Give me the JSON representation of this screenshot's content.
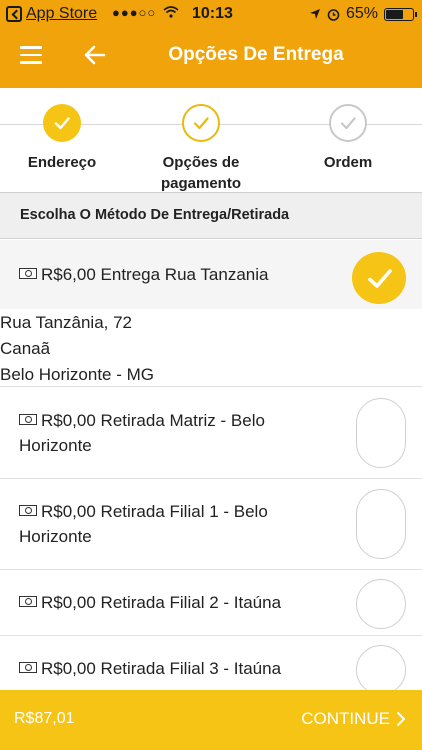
{
  "status_bar": {
    "back_app_label": "App Store",
    "signal": "●●●○○",
    "time": "10:13",
    "battery": "65%",
    "battery_level": 0.65
  },
  "header": {
    "title": "Opções De Entrega"
  },
  "stepper": {
    "steps": [
      {
        "label": "Endereço",
        "state": "done"
      },
      {
        "label": "Opções de pagamento",
        "state": "current"
      },
      {
        "label": "Ordem",
        "state": "todo"
      }
    ]
  },
  "section": {
    "title": "Escolha O Método De Entrega/Retirada"
  },
  "options": [
    {
      "label": "R$6,00 Entrega Rua Tanzania",
      "selected": true
    },
    {
      "label": "R$0,00 Retirada Matriz - Belo Horizonte",
      "selected": false
    },
    {
      "label": "R$0,00 Retirada Filial 1 - Belo Horizonte",
      "selected": false
    },
    {
      "label": "R$0,00 Retirada Filial 2 - Itaúna",
      "selected": false
    },
    {
      "label": "R$0,00 Retirada Filial 3 - Itaúna",
      "selected": false
    }
  ],
  "address": {
    "line1": "Rua Tanzânia, 72",
    "line2": "Canaã",
    "line3": "Belo Horizonte - MG"
  },
  "footer": {
    "total": "R$87,01",
    "continue_label": "CONTINUE"
  },
  "colors": {
    "header": "#f0a30a",
    "accent": "#f5c414"
  }
}
